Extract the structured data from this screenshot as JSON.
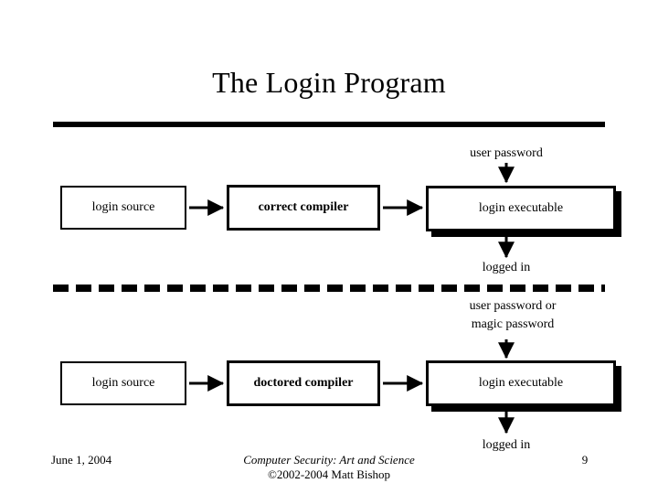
{
  "slide": {
    "title": "The Login Program",
    "page_number": "9",
    "date": "June 1, 2004",
    "footer_line1": "Computer Security: Art and Science",
    "footer_line2": "©2002-2004 Matt Bishop"
  },
  "diagram": {
    "type": "flow",
    "top_row": {
      "source_box": "login source",
      "compiler_box": "correct compiler",
      "executable_box": "login executable",
      "input_label": "user password",
      "output_label": "logged in"
    },
    "bottom_row": {
      "source_box": "login source",
      "compiler_box": "doctored compiler",
      "executable_box": "login executable",
      "input_label": "user password or\nmagic password",
      "output_label": "logged in"
    }
  },
  "colors": {
    "stroke": "#000000",
    "background": "#ffffff"
  }
}
